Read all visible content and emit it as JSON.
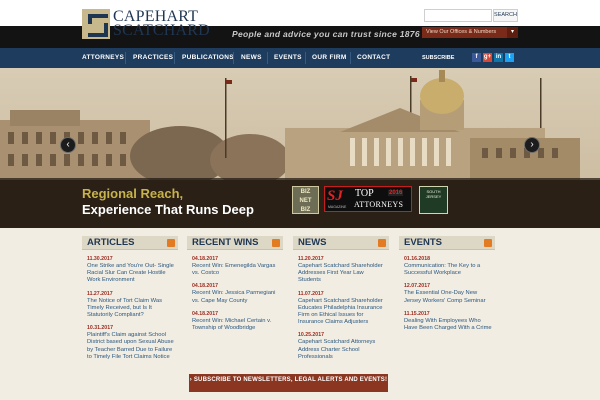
{
  "header": {
    "logo_line1": "CAPEHART",
    "logo_line2": "SCATCHARD",
    "tagline": "People and advice you can trust since 1876",
    "search_placeholder": "",
    "search_button": "SEARCH",
    "offices_button": "View Our Offices & Numbers",
    "offices_arrow": "▾"
  },
  "nav": {
    "items": [
      "ATTORNEYS",
      "PRACTICES",
      "PUBLICATIONS",
      "NEWS",
      "EVENTS",
      "OUR FIRM",
      "CONTACT"
    ],
    "subscribe": "SUBSCRIBE",
    "social": [
      "f",
      "g+",
      "in",
      "t"
    ]
  },
  "colors": {
    "nav_bg": "#1d3c5e",
    "accent_red": "#8a3621",
    "headline_gold": "#c8b34a",
    "link_blue": "#2a5780",
    "date_red": "#9c2b20"
  },
  "hero": {
    "prev": "‹",
    "next": "›",
    "line1": "Regional Reach,",
    "line2": "Experience That Runs Deep",
    "badges": {
      "biz": "BIZ\nNET\nBIZ",
      "sj": "SJ",
      "top": "TOP",
      "year": "2016",
      "attorneys": "ATTORNEYS",
      "sj_magazine": "MAGAZINE",
      "south_jersey": "SOUTH JERSEY"
    }
  },
  "columns": [
    {
      "title": "ARTICLES",
      "items": [
        {
          "date": "11.30.2017",
          "text": "One Strike and You're Out- Single Racial Slur Can Create Hostile Work Environment"
        },
        {
          "date": "11.27.2017",
          "text": "The Notice of Tort Claim Was Timely Received, but Is It Statutorily Compliant?"
        },
        {
          "date": "10.31.2017",
          "text": "Plaintiff's Claim against School District based upon Sexual Abuse by Teacher Barred Due to Failure to Timely File Tort Claims Notice"
        }
      ]
    },
    {
      "title": "RECENT WINS",
      "items": [
        {
          "date": "04.18.2017",
          "text": "Recent Win: Emenegilda Vargas vs. Costco"
        },
        {
          "date": "04.18.2017",
          "text": "Recent Win: Jessica Parmegiani vs. Cape May County"
        },
        {
          "date": "04.18.2017",
          "text": "Recent Win: Michael Certain v. Township of Woodbridge"
        }
      ]
    },
    {
      "title": "NEWS",
      "items": [
        {
          "date": "11.20.2017",
          "text": "Capehart Scatchard Shareholder Addresses First Year Law Students"
        },
        {
          "date": "11.07.2017",
          "text": "Capehart Scatchard Shareholder Educates Philadelphia Insurance Firm on Ethical Issues for Insurance Claims Adjusters"
        },
        {
          "date": "10.25.2017",
          "text": "Capehart Scatchard Attorneys Address Charter School Professionals"
        }
      ]
    },
    {
      "title": "EVENTS",
      "items": [
        {
          "date": "01.16.2018",
          "text": "Communication: The Key to a Successful Workplace"
        },
        {
          "date": "12.07.2017",
          "text": "The Essential One-Day New Jersey Workers' Comp Seminar"
        },
        {
          "date": "11.15.2017",
          "text": "Dealing With Employees Who Have Been Charged With a Crime"
        }
      ]
    }
  ],
  "cta": {
    "label": "› SUBSCRIBE TO NEWSLETTERS, LEGAL ALERTS AND EVENTS!"
  }
}
